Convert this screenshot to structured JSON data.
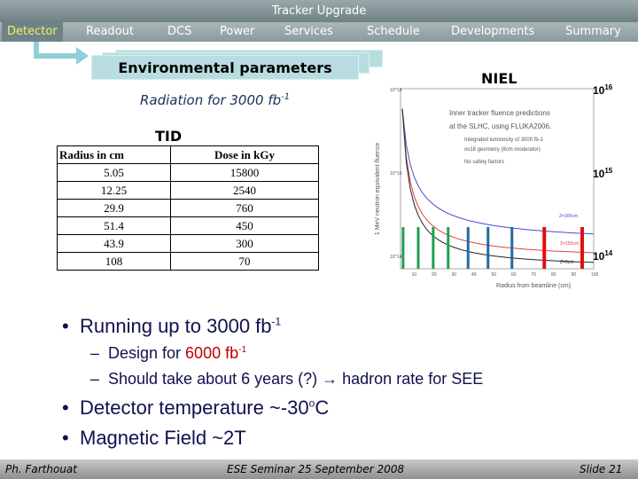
{
  "header": {
    "title": "Tracker Upgrade"
  },
  "nav": {
    "items": [
      {
        "label": "Detector",
        "active": true
      },
      {
        "label": "Readout"
      },
      {
        "label": "DCS"
      },
      {
        "label": "Power"
      },
      {
        "label": "Services"
      },
      {
        "label": "Schedule"
      },
      {
        "label": "Developments"
      },
      {
        "label": "Summary"
      }
    ]
  },
  "section": {
    "title": "Environmental parameters"
  },
  "radiation": {
    "text": "Radiation for 3000 fb",
    "sup": "-1"
  },
  "tid": {
    "title": "TID",
    "headers": [
      "Radius in cm",
      "Dose in kGy"
    ],
    "rows": [
      [
        "5.05",
        "15800"
      ],
      [
        "12.25",
        "2540"
      ],
      [
        "29.9",
        "760"
      ],
      [
        "51.4",
        "450"
      ],
      [
        "43.9",
        "300"
      ],
      [
        "108",
        "70"
      ]
    ]
  },
  "niel": {
    "title": "NIEL",
    "scale_labels": [
      {
        "base": "10",
        "exp": "16"
      },
      {
        "base": "10",
        "exp": "15"
      },
      {
        "base": "10",
        "exp": "14"
      }
    ],
    "plot": {
      "title_line1": "Inner tracker fluence predictions",
      "title_line2": "at the SLHC, using FLUKA2006.",
      "legend": [
        "Integrated luminosity of 3000 fb-1",
        "ov18 geometry (8cm moderator)",
        "No safety factors"
      ],
      "ylabel": "1 MeV neutron equivalent fluence",
      "xlabel": "Radius from beamline (cm)",
      "xticks": [
        "10",
        "20",
        "30",
        "40",
        "50",
        "60",
        "70",
        "80",
        "90",
        "100"
      ],
      "yticks": [
        "10^16",
        "10^15",
        "10^14"
      ],
      "curve_labels": [
        "Z=300cm",
        "Z=150cm",
        "Z=0cm"
      ],
      "colors": {
        "z300": "#4a4ad0",
        "z150": "#e04040",
        "z0": "#222222",
        "green": "#1fa050",
        "blue": "#1e6aa8",
        "red": "#e01010"
      }
    }
  },
  "bullets": {
    "b1": {
      "text": "Running up to 3000 fb",
      "sup": "-1"
    },
    "b1a": {
      "pre": "Design for ",
      "red": "6000 fb",
      "sup": "-1"
    },
    "b1b": {
      "text": "Should take about 6 years (?) → hadron rate for SEE"
    },
    "b2": {
      "text": "Detector temperature ~-30",
      "sup": "o",
      "post": "C"
    },
    "b3": {
      "text": "Magnetic Field ~2T"
    }
  },
  "footer": {
    "author": "Ph. Farthouat",
    "event": "ESE Seminar 25 September 2008",
    "slide": "Slide 21"
  }
}
